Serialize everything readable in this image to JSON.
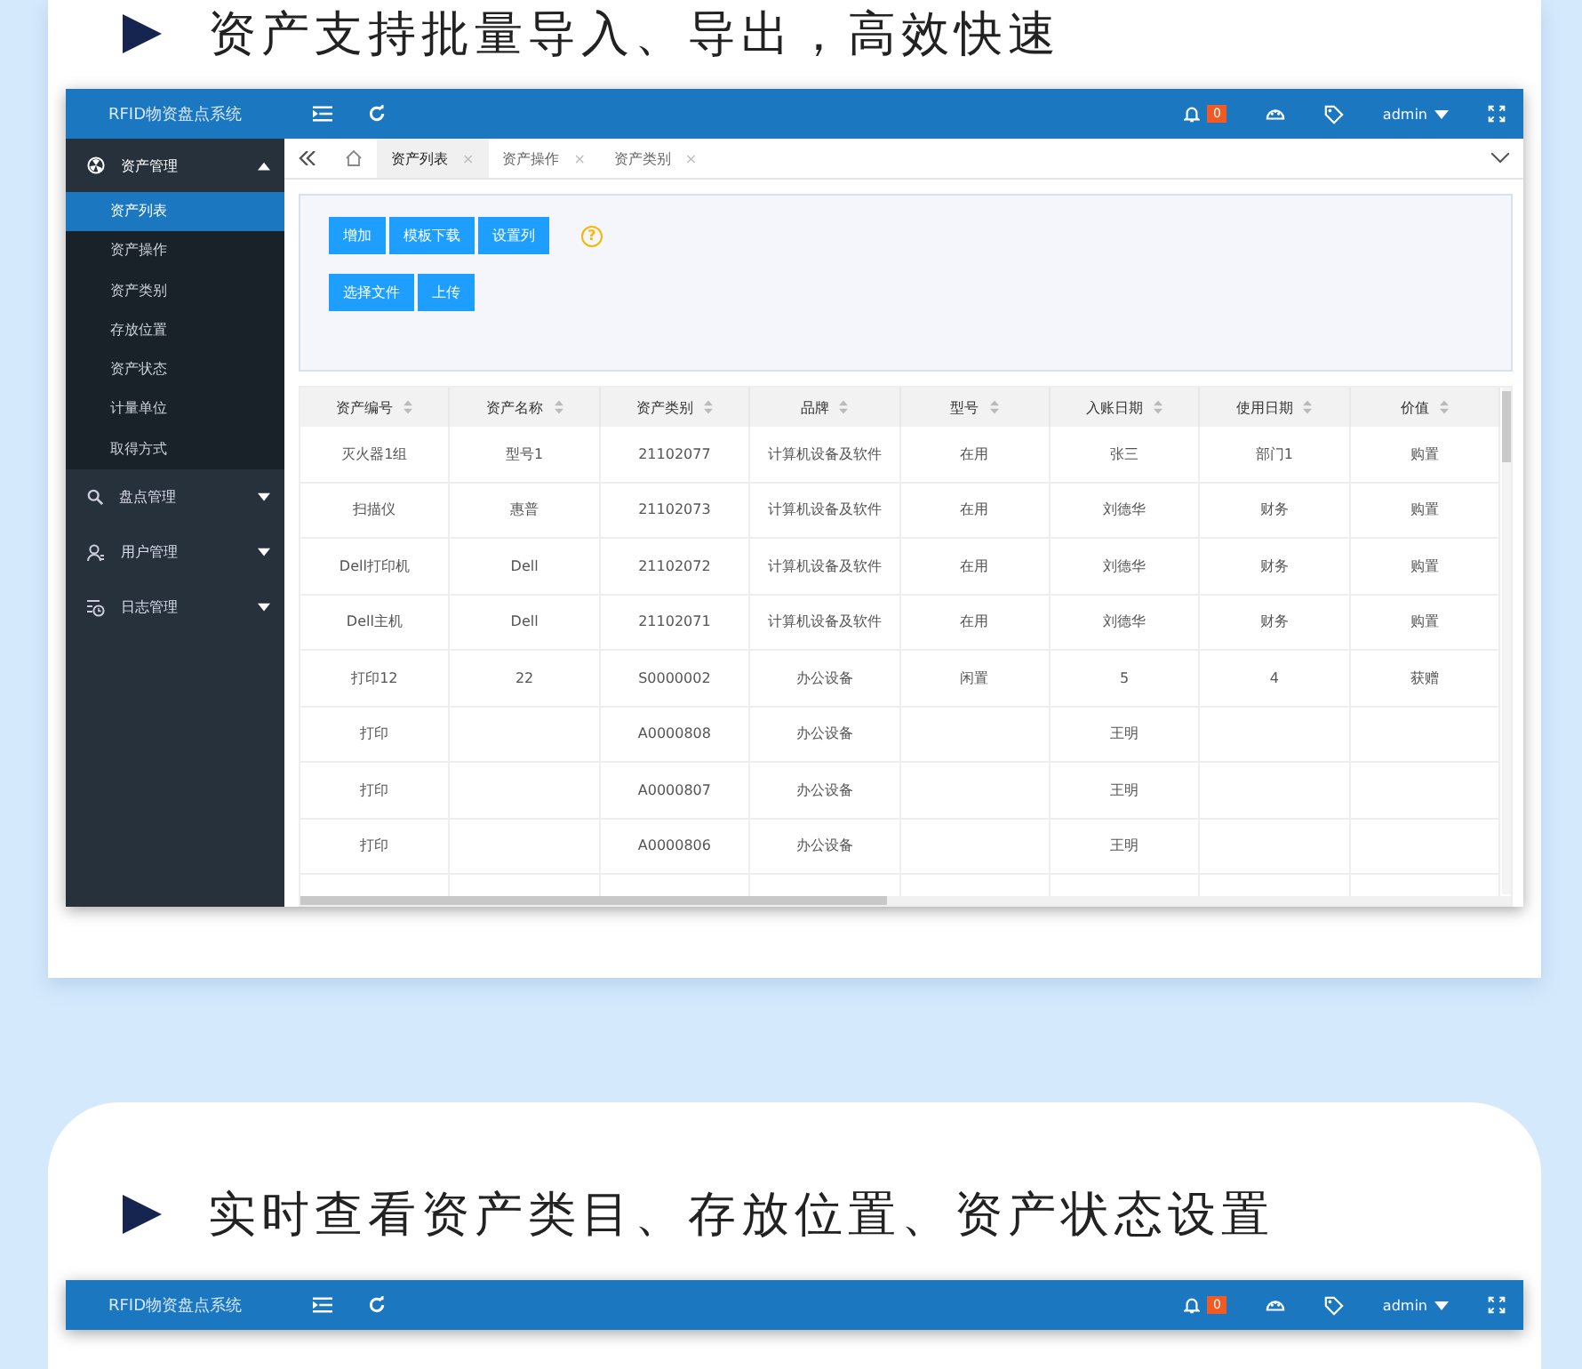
{
  "sections": [
    {
      "title": "资产支持批量导入、导出，高效快速",
      "app": {
        "brand": "RFID物资盘点系统",
        "notifications": "0",
        "user": "admin",
        "menu": [
          {
            "label": "资产管理",
            "expanded": true,
            "children": [
              {
                "label": "资产列表",
                "selected": true
              },
              {
                "label": "资产操作",
                "selected": false
              },
              {
                "label": "资产类别",
                "selected": false
              },
              {
                "label": "存放位置",
                "selected": false
              },
              {
                "label": "资产状态",
                "selected": false
              },
              {
                "label": "计量单位",
                "selected": false
              },
              {
                "label": "取得方式",
                "selected": false
              }
            ]
          },
          {
            "label": "盘点管理",
            "expanded": false
          },
          {
            "label": "用户管理",
            "expanded": false
          },
          {
            "label": "日志管理",
            "expanded": false
          }
        ],
        "tabs": [
          {
            "label": "资产列表",
            "close": "×",
            "selected": true
          },
          {
            "label": "资产操作",
            "close": "×",
            "selected": false
          },
          {
            "label": "资产类别",
            "close": "×",
            "selected": false
          }
        ],
        "toolbar": [
          [
            "增加",
            "模板下载",
            "设置列"
          ],
          [
            "选择文件",
            "上传"
          ]
        ],
        "help": "?",
        "table": {
          "columns": [
            "资产编号",
            "资产名称",
            "资产类别",
            "品牌",
            "型号",
            "入账日期",
            "使用日期",
            "价值"
          ],
          "rows": [
            [
              "灭火器1组",
              "型号1",
              "21102077",
              "计算机设备及软件",
              "在用",
              "张三",
              "部门1",
              "购置"
            ],
            [
              "扫描仪",
              "惠普",
              "21102073",
              "计算机设备及软件",
              "在用",
              "刘德华",
              "财务",
              "购置"
            ],
            [
              "Dell打印机",
              "Dell",
              "21102072",
              "计算机设备及软件",
              "在用",
              "刘德华",
              "财务",
              "购置"
            ],
            [
              "Dell主机",
              "Dell",
              "21102071",
              "计算机设备及软件",
              "在用",
              "刘德华",
              "财务",
              "购置"
            ],
            [
              "打印12",
              "22",
              "S0000002",
              "办公设备",
              "闲置",
              "5",
              "4",
              "获赠"
            ],
            [
              "打印",
              null,
              "A0000808",
              "办公设备",
              null,
              "王明",
              null,
              null
            ],
            [
              "打印",
              null,
              "A0000807",
              "办公设备",
              null,
              "王明",
              null,
              null
            ],
            [
              "打印",
              null,
              "A0000806",
              "办公设备",
              null,
              "王明",
              null,
              null
            ]
          ]
        }
      }
    },
    {
      "title": "实时查看资产类目、存放位置、资产状态设置",
      "app": {
        "brand": "RFID物资盘点系统",
        "notifications": "0",
        "user": "admin"
      }
    }
  ]
}
